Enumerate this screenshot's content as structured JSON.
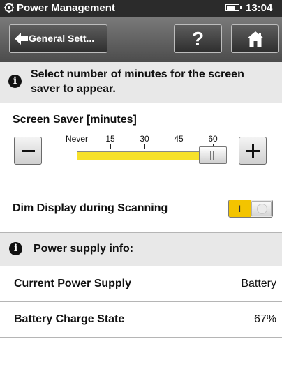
{
  "status_bar": {
    "title": "Power Management",
    "battery_level": 0.75,
    "time": "13:04"
  },
  "nav": {
    "back_label": "General Sett...",
    "help_label": "?"
  },
  "info_message": "Select number of minutes for the screen saver to appear.",
  "screen_saver": {
    "label": "Screen Saver [minutes]",
    "ticks": [
      "Never",
      "15",
      "30",
      "45",
      "60"
    ],
    "selected": "60"
  },
  "dim_display": {
    "label": "Dim Display during Scanning",
    "toggle_on_label": "I",
    "enabled": true
  },
  "power_info": {
    "header": "Power supply info:",
    "rows": [
      {
        "label": "Current Power Supply",
        "value": "Battery"
      },
      {
        "label": "Battery Charge State",
        "value": "67%"
      }
    ]
  }
}
